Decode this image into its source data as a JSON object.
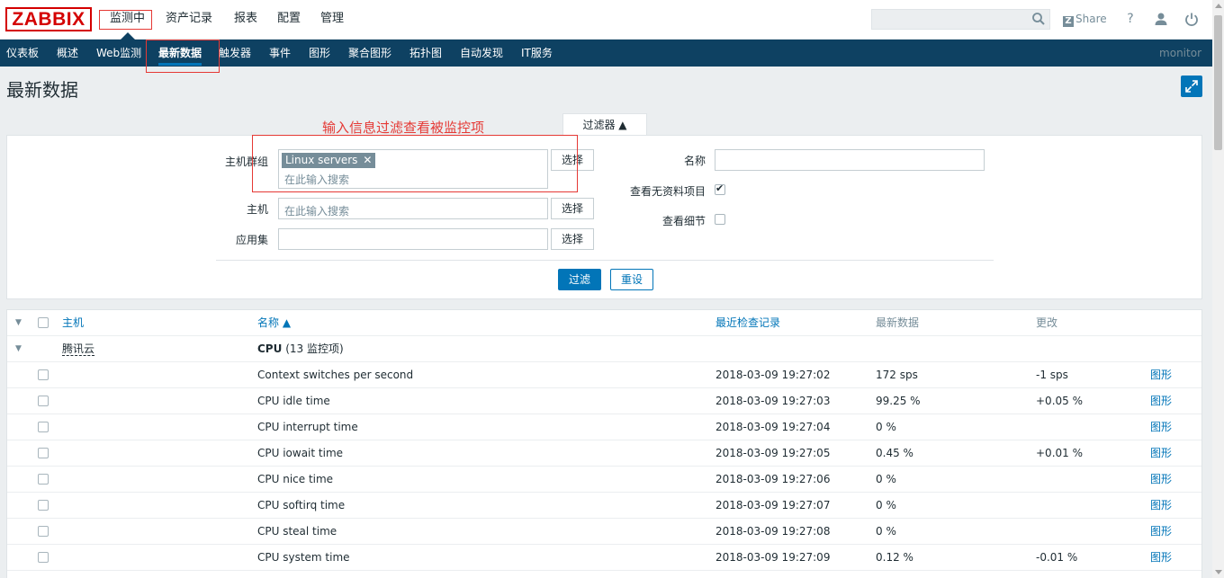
{
  "logo": "ZABBIX",
  "top_menu": [
    {
      "label": "监测中"
    },
    {
      "label": "资产记录"
    },
    {
      "label": "报表"
    },
    {
      "label": "配置"
    },
    {
      "label": "管理"
    }
  ],
  "topbar": {
    "search_placeholder": "",
    "share_label": "Share",
    "share_icon_letter": "Z",
    "help_glyph": "?"
  },
  "nav": [
    {
      "label": "仪表板"
    },
    {
      "label": "概述"
    },
    {
      "label": "Web监测"
    },
    {
      "label": "最新数据"
    },
    {
      "label": "触发器"
    },
    {
      "label": "事件"
    },
    {
      "label": "图形"
    },
    {
      "label": "聚合图形"
    },
    {
      "label": "拓扑图"
    },
    {
      "label": "自动发现"
    },
    {
      "label": "IT服务"
    }
  ],
  "nav_user": "monitor",
  "page_title": "最新数据",
  "annotation": "输入信息过滤查看被监控项",
  "filter": {
    "tab_label": "过滤器 ▲",
    "host_group_label": "主机群组",
    "host_group_tag": "Linux servers",
    "host_group_placeholder": "在此输入搜索",
    "host_label": "主机",
    "host_placeholder": "在此输入搜索",
    "app_label": "应用集",
    "select_label": "选择",
    "name_label": "名称",
    "show_without_data_label": "查看无资料项目",
    "show_without_data": true,
    "show_details_label": "查看细节",
    "show_details": false,
    "apply_label": "过滤",
    "reset_label": "重设"
  },
  "table": {
    "headers": {
      "host": "主机",
      "name": "名称 ▲",
      "last_check": "最近检查记录",
      "last_value": "最新数据",
      "change": "更改"
    },
    "group": {
      "host": "腾讯云",
      "app": "CPU",
      "count": "(13 监控项)"
    },
    "graph_label": "图形",
    "rows": [
      {
        "name": "Context switches per second",
        "last_check": "2018-03-09 19:27:02",
        "last_value": "172 sps",
        "change": "-1 sps"
      },
      {
        "name": "CPU idle time",
        "last_check": "2018-03-09 19:27:03",
        "last_value": "99.25 %",
        "change": "+0.05 %"
      },
      {
        "name": "CPU interrupt time",
        "last_check": "2018-03-09 19:27:04",
        "last_value": "0 %",
        "change": ""
      },
      {
        "name": "CPU iowait time",
        "last_check": "2018-03-09 19:27:05",
        "last_value": "0.45 %",
        "change": "+0.01 %"
      },
      {
        "name": "CPU nice time",
        "last_check": "2018-03-09 19:27:06",
        "last_value": "0 %",
        "change": ""
      },
      {
        "name": "CPU softirq time",
        "last_check": "2018-03-09 19:27:07",
        "last_value": "0 %",
        "change": ""
      },
      {
        "name": "CPU steal time",
        "last_check": "2018-03-09 19:27:08",
        "last_value": "0 %",
        "change": ""
      },
      {
        "name": "CPU system time",
        "last_check": "2018-03-09 19:27:09",
        "last_value": "0.12 %",
        "change": "-0.01 %"
      }
    ]
  },
  "colors": {
    "brand": "#d40000",
    "nav_bg": "#0e4162",
    "accent": "#0275b8",
    "annotation": "#e53935"
  }
}
